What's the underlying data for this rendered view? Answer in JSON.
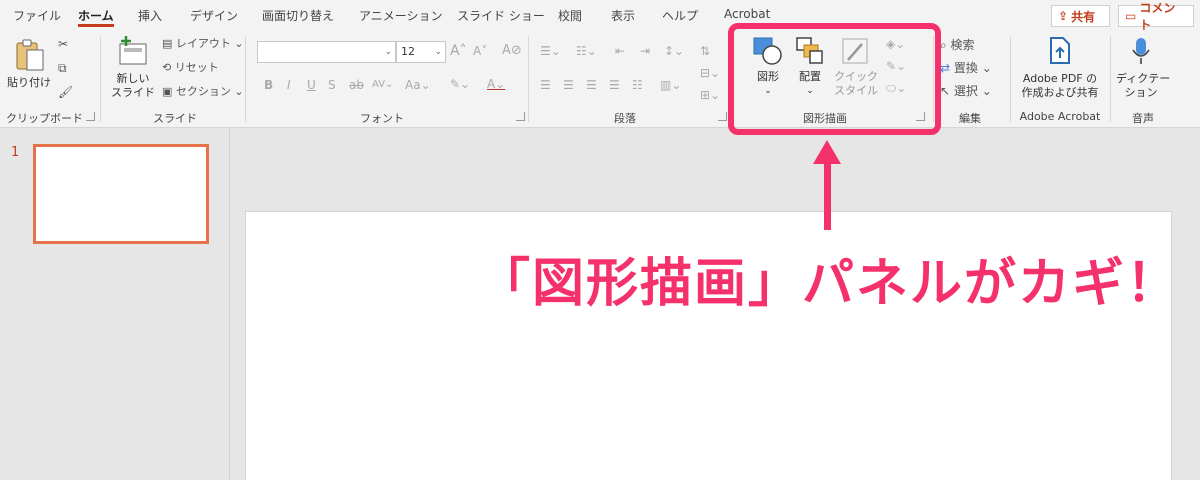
{
  "tabs": [
    {
      "label": "ファイル",
      "active": false
    },
    {
      "label": "ホーム",
      "active": true
    },
    {
      "label": "挿入",
      "active": false
    },
    {
      "label": "デザイン",
      "active": false
    },
    {
      "label": "画面切り替え",
      "active": false
    },
    {
      "label": "アニメーション",
      "active": false
    },
    {
      "label": "スライド ショー",
      "active": false
    },
    {
      "label": "校閲",
      "active": false
    },
    {
      "label": "表示",
      "active": false
    },
    {
      "label": "ヘルプ",
      "active": false
    },
    {
      "label": "Acrobat",
      "active": false
    }
  ],
  "share_label": "共有",
  "comment_label": "コメント",
  "ribbon": {
    "clipboard": {
      "paste_label": "貼り付け",
      "group_label": "クリップボード"
    },
    "slides": {
      "new_slide_line1": "新しい",
      "new_slide_line2": "スライド",
      "layout_label": "レイアウト",
      "reset_label": "リセット",
      "section_label": "セクション",
      "group_label": "スライド"
    },
    "font": {
      "font_name": "",
      "font_size": "12",
      "group_label": "フォント"
    },
    "paragraph": {
      "group_label": "段落"
    },
    "drawing": {
      "shapes_label": "図形",
      "arrange_label": "配置",
      "quick_style_line1": "クイック",
      "quick_style_line2": "スタイル",
      "group_label": "図形描画"
    },
    "editing": {
      "find_label": "検索",
      "replace_label": "置換",
      "select_label": "選択",
      "group_label": "編集"
    },
    "acrobat": {
      "line1": "Adobe PDF の",
      "line2": "作成および共有",
      "group_label": "Adobe Acrobat"
    },
    "voice": {
      "line1": "ディクテー",
      "line2": "ション",
      "group_label": "音声"
    }
  },
  "thumbnails": [
    {
      "number": "1"
    }
  ],
  "annotation": {
    "callout_text": "「図形描画」パネルがカギ！"
  },
  "colors": {
    "accent": "#c43e1c",
    "highlight": "#f5316c",
    "thumb_border": "#e5734a"
  }
}
